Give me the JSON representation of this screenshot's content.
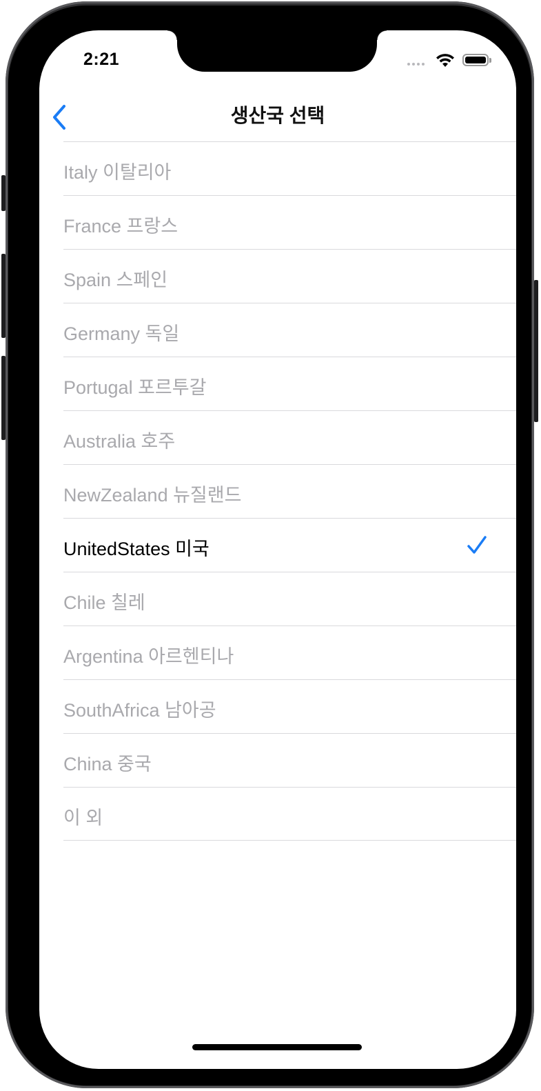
{
  "status_bar": {
    "time": "2:21"
  },
  "nav": {
    "title": "생산국 선택",
    "back_icon": "chevron-left-icon"
  },
  "accent_color": "#1a7cf5",
  "countries": [
    {
      "label": "Italy 이탈리아",
      "selected": false
    },
    {
      "label": "France 프랑스",
      "selected": false
    },
    {
      "label": "Spain 스페인",
      "selected": false
    },
    {
      "label": "Germany 독일",
      "selected": false
    },
    {
      "label": "Portugal 포르투갈",
      "selected": false
    },
    {
      "label": "Australia 호주",
      "selected": false
    },
    {
      "label": "NewZealand 뉴질랜드",
      "selected": false
    },
    {
      "label": "UnitedStates 미국",
      "selected": true
    },
    {
      "label": "Chile 칠레",
      "selected": false
    },
    {
      "label": "Argentina 아르헨티나",
      "selected": false
    },
    {
      "label": "SouthAfrica 남아공",
      "selected": false
    },
    {
      "label": "China 중국",
      "selected": false
    },
    {
      "label": "이 외",
      "selected": false
    }
  ]
}
